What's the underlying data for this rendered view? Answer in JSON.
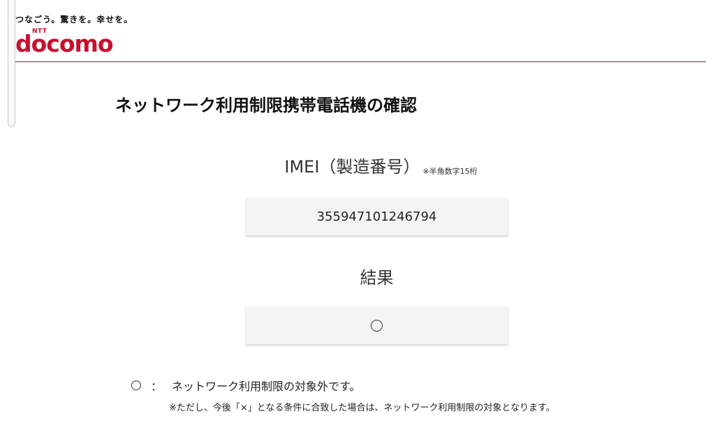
{
  "header": {
    "tagline": "つなごう。驚きを。幸せを。",
    "logo_small": "NTT",
    "logo_brand": "docomo",
    "brand_color": "#c8102e"
  },
  "main": {
    "title": "ネットワーク利用制限携帯電話機の確認",
    "imei": {
      "label": "IMEI（製造番号）",
      "note": "※半角数字15桁",
      "value": "355947101246794"
    },
    "result": {
      "label": "結果",
      "value_icon": "circle-icon"
    },
    "legend": {
      "mark_icon": "circle-icon",
      "colon": "：",
      "text": "ネットワーク利用制限の対象外です。",
      "note": "※ただし、今後「×」となる条件に合致した場合は、ネットワーク利用制限の対象となります。"
    }
  }
}
